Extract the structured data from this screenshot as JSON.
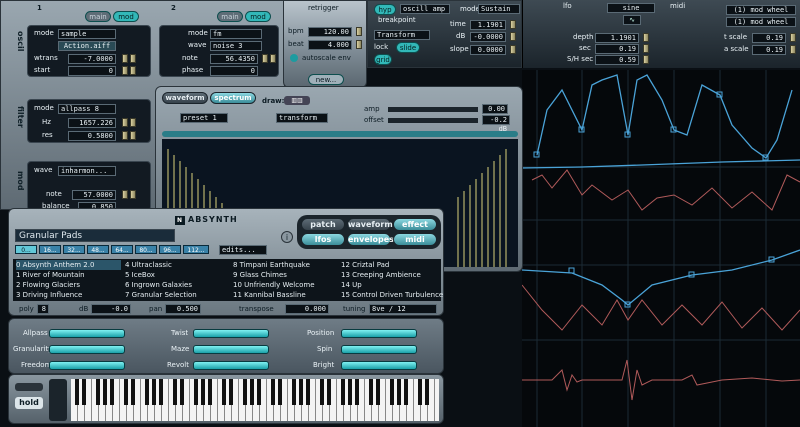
{
  "osc": {
    "num1": "1",
    "num2": "2",
    "toggle_main": "main",
    "toggle_mod": "mod",
    "section_oscil": "oscil",
    "section_filter": "filter",
    "section_mod": "mod",
    "osc1": {
      "mode_label": "mode",
      "mode_value": "sample",
      "aux_value": "Action.aiff",
      "wtrans_label": "wtrans",
      "wtrans_value": "-7.0000",
      "start_label": "start",
      "start_value": "0"
    },
    "osc2": {
      "mode_label": "mode",
      "mode_value": "fm",
      "wave_label": "wave",
      "wave_value": "noise 3",
      "note_label": "note",
      "note_value": "56.4350",
      "phase_label": "phase",
      "phase_value": "0"
    },
    "filter": {
      "mode_label": "mode",
      "mode_value": "allpass 8",
      "hz_label": "Hz",
      "hz_value": "1657.226",
      "res_label": "res",
      "res_value": "0.5800"
    },
    "mod": {
      "wave_label": "wave",
      "wave_value": "inharmon...",
      "note_label": "note",
      "note_value": "57.0000",
      "balance_label": "balance",
      "balance_value": "0.850"
    }
  },
  "retrigger": {
    "title": "retrigger",
    "bpm_label": "bpm",
    "bpm_value": "120.00",
    "beat_label": "beat",
    "beat_value": "4.000",
    "autoscale_label": "autoscale env",
    "new_label": "new..."
  },
  "envelope": {
    "hyp_label": "hyp",
    "source_value": "oscill amp",
    "breakpoint_label": "breakpoint",
    "mode_label": "mode",
    "mode_value": "Sustain",
    "transform_value": "Transform",
    "lock_label": "lock",
    "slide_label": "slide",
    "grid_label": "grid",
    "time_label": "time",
    "time_value": "1.1901",
    "db_label": "dB",
    "db_value": "-0.0000",
    "slope_label": "slope",
    "slope_value": "0.0000"
  },
  "lfo": {
    "title": "lfo",
    "wave_value": "sine",
    "depth_label": "depth",
    "depth_value": "1.1901",
    "sec_label": "sec",
    "sec_value": "0.19",
    "smsec_label": "S/H sec",
    "smsec_value": "0.59"
  },
  "midi": {
    "title": "midi",
    "source1": "(1) mod wheel",
    "source2": "(1) mod wheel",
    "tscale_label": "t scale",
    "tscale_value": "0.19",
    "ascale_label": "a scale",
    "ascale_value": "0.19"
  },
  "waveform_editor": {
    "tab_waveform": "waveform",
    "tab_spectrum": "spectrum",
    "draw_label": "draw:",
    "amp_label": "amp",
    "amp_value": "0.00",
    "offset_label": "offset",
    "offset_value": "-0.2 dB",
    "preset_value": "preset 1",
    "transform_value": "transform"
  },
  "browser": {
    "title": "Granular Pads",
    "logo": "ABSYNTH",
    "tabs": [
      "patch",
      "waveform",
      "effect",
      "lfos",
      "envelopes",
      "midi"
    ],
    "bank_buttons": [
      "0...",
      "16...",
      "32...",
      "48...",
      "64...",
      "80...",
      "96...",
      "112..."
    ],
    "edits_label": "edits...",
    "columns": [
      [
        "0 Absynth Anthem 2.0",
        "1 River of Mountain",
        "2 Flowing Glaciers",
        "3 Driving Influence"
      ],
      [
        "4 Ultraclassic",
        "5 IceBox",
        "6 Ingrown Galaxies",
        "7 Granular Selection"
      ],
      [
        "8 Timpani Earthquake",
        "9 Glass Chimes",
        "10 Unfriendly Welcome",
        "11 Kannibal Bassline"
      ],
      [
        "12 Criztal Pad",
        "13 Creeping Ambience",
        "14 Up",
        "15 Control Driven Turbulence"
      ]
    ],
    "poly_label": "poly",
    "poly_value": "8",
    "db_label": "dB",
    "db_value": "-0.0",
    "pan_label": "pan",
    "pan_value": "0.500",
    "transpose_label": "transpose",
    "transpose_value": "0.000",
    "tuning_label": "tuning",
    "tuning_value": "8ve / 12"
  },
  "macros": {
    "col1": [
      "Allpass",
      "Granularity",
      "Freedom"
    ],
    "col2": [
      "Twist",
      "Maze",
      "Revolt"
    ],
    "col3": [
      "Position",
      "Spin",
      "Bright"
    ]
  },
  "keyboard": {
    "hold_label": "hold"
  },
  "colors": {
    "accent": "#32b8b8",
    "envelope_line": "#4aa3d8",
    "wave_line": "#b05a5a"
  }
}
